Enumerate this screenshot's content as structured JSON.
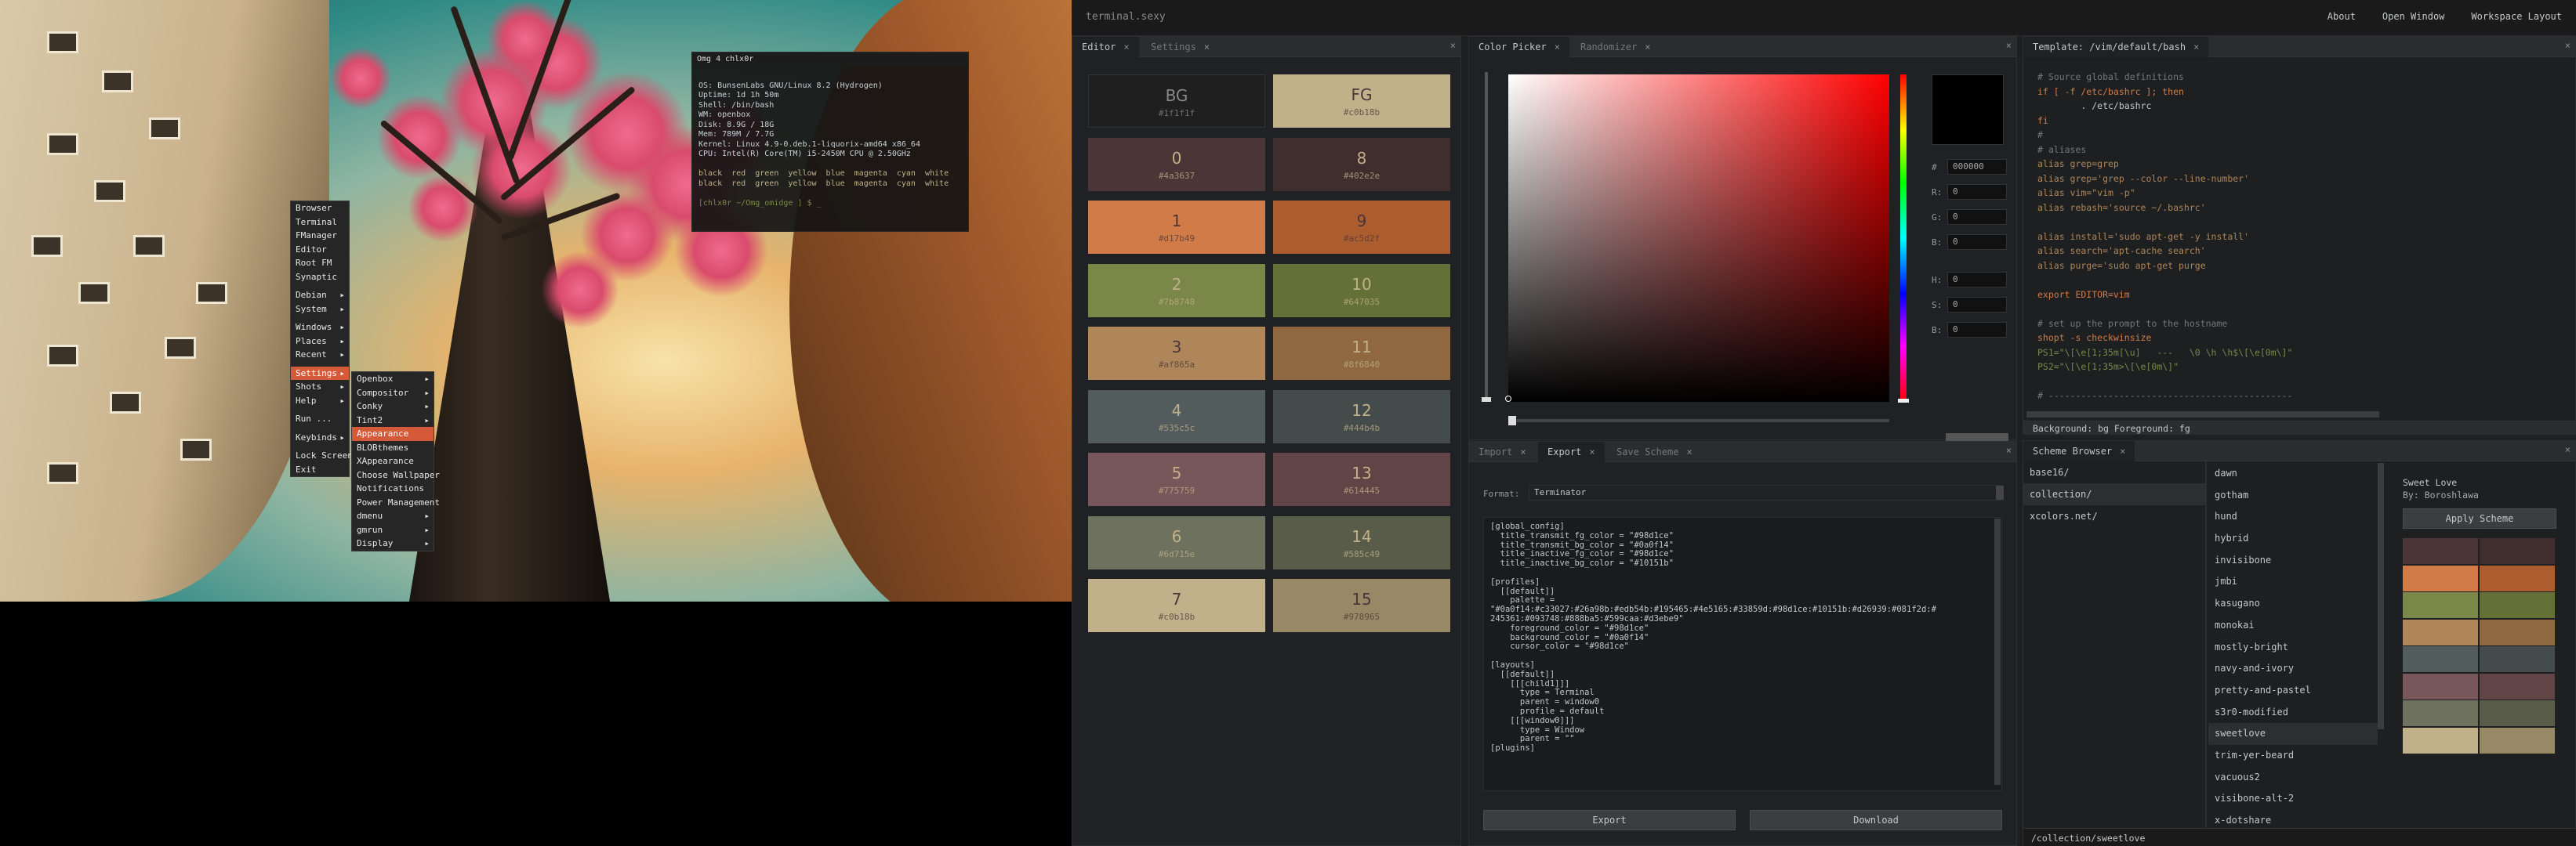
{
  "preview": {
    "term_title": "Omg 4 chlx0r",
    "term_lines": [
      "",
      "OS: BunsenLabs GNU/Linux 8.2 (Hydrogen)",
      "Uptime: 1d 1h 50m",
      "Shell: /bin/bash",
      "WM: openbox",
      "Disk: 8.9G / 18G",
      "Mem: 789M / 7.7G",
      "Kernel: Linux 4.9-0.deb.1-liquorix-amd64 x86_64",
      "CPU: Intel(R) Core(TM) i5-2450M CPU @ 2.50GHz",
      "",
      "black  red  green  yellow  blue  magenta  cyan  white",
      "black  red  green  yellow  blue  magenta  cyan  white",
      "",
      "[chlx0r ~/Omg_omidge ] $ _"
    ],
    "menu1": [
      {
        "t": "Browser"
      },
      {
        "t": "Terminal"
      },
      {
        "t": "FManager"
      },
      {
        "t": "Editor"
      },
      {
        "t": "Root FM"
      },
      {
        "t": "Synaptic"
      },
      {
        "t": "Debian",
        "a": true,
        "s": true
      },
      {
        "t": "System",
        "a": true
      },
      {
        "t": "Windows",
        "a": true,
        "s": true
      },
      {
        "t": "Places",
        "a": true
      },
      {
        "t": "Recent",
        "a": true
      },
      {
        "t": "Settings",
        "a": true,
        "s": true,
        "h": true
      },
      {
        "t": "Shots",
        "a": true
      },
      {
        "t": "Help",
        "a": true
      },
      {
        "t": "Run ...",
        "s": true
      },
      {
        "t": "Keybinds",
        "a": true,
        "s": true
      },
      {
        "t": "Lock Screen",
        "s": true
      },
      {
        "t": "Exit"
      }
    ],
    "menu2": [
      {
        "t": "Openbox",
        "a": true
      },
      {
        "t": "Compositor",
        "a": true
      },
      {
        "t": "Conky",
        "a": true
      },
      {
        "t": "Tint2",
        "a": true
      },
      {
        "t": "Appearance",
        "h": true
      },
      {
        "t": "BLOBthemes"
      },
      {
        "t": "XAppearance"
      },
      {
        "t": "Choose Wallpaper"
      },
      {
        "t": "Notifications"
      },
      {
        "t": "Power Management"
      },
      {
        "t": "dmenu",
        "a": true
      },
      {
        "t": "gmrun",
        "a": true
      },
      {
        "t": "Display",
        "a": true
      }
    ]
  },
  "nav": {
    "brand": "terminal.sexy",
    "links": [
      "About",
      "Open Window",
      "Workspace Layout"
    ]
  },
  "editor": {
    "tabs": [
      "Editor",
      "Settings"
    ],
    "swatches": [
      {
        "name": "BG",
        "hex": "#1f1f1f",
        "bg": "#1f1f1f",
        "fg": "#8a8a8a"
      },
      {
        "name": "FG",
        "hex": "#c0b18b",
        "bg": "#c0b18b",
        "fg": "#4a3637"
      },
      {
        "name": "0",
        "hex": "#4a3637",
        "bg": "#4a3637",
        "fg": "#c0b18b"
      },
      {
        "name": "8",
        "hex": "#402e2e",
        "bg": "#402e2e",
        "fg": "#c0b18b"
      },
      {
        "name": "1",
        "hex": "#d17b49",
        "bg": "#d17b49",
        "fg": "#4a3637"
      },
      {
        "name": "9",
        "hex": "#ac5d2f",
        "bg": "#ac5d2f",
        "fg": "#4a3637"
      },
      {
        "name": "2",
        "hex": "#7b8748",
        "bg": "#7b8748",
        "fg": "#c0b18b"
      },
      {
        "name": "10",
        "hex": "#647035",
        "bg": "#647035",
        "fg": "#c0b18b"
      },
      {
        "name": "3",
        "hex": "#af865a",
        "bg": "#af865a",
        "fg": "#4a3637"
      },
      {
        "name": "11",
        "hex": "#8f6840",
        "bg": "#8f6840",
        "fg": "#c0b18b"
      },
      {
        "name": "4",
        "hex": "#535c5c",
        "bg": "#535c5c",
        "fg": "#c0b18b"
      },
      {
        "name": "12",
        "hex": "#444b4b",
        "bg": "#444b4b",
        "fg": "#c0b18b"
      },
      {
        "name": "5",
        "hex": "#775759",
        "bg": "#775759",
        "fg": "#c0b18b"
      },
      {
        "name": "13",
        "hex": "#614445",
        "bg": "#614445",
        "fg": "#c0b18b"
      },
      {
        "name": "6",
        "hex": "#6d715e",
        "bg": "#6d715e",
        "fg": "#c0b18b"
      },
      {
        "name": "14",
        "hex": "#585c49",
        "bg": "#585c49",
        "fg": "#c0b18b"
      },
      {
        "name": "7",
        "hex": "#c0b18b",
        "bg": "#c0b18b",
        "fg": "#4a3637"
      },
      {
        "name": "15",
        "hex": "#978965",
        "bg": "#978965",
        "fg": "#4a3637"
      }
    ]
  },
  "picker": {
    "tabs": [
      "Color Picker",
      "Randomizer"
    ],
    "fields": [
      {
        "k": "#",
        "v": "000000"
      },
      {
        "k": "R:",
        "v": "0"
      },
      {
        "k": "G:",
        "v": "0"
      },
      {
        "k": "B:",
        "v": "0"
      },
      {
        "k": "H:",
        "v": "0"
      },
      {
        "k": "S:",
        "v": "0"
      },
      {
        "k": "B:",
        "v": "0"
      }
    ]
  },
  "template": {
    "tabs": [
      "Template: /vim/default/bash"
    ],
    "lines": [
      {
        "t": "# Source global definitions",
        "c": "#707880"
      },
      {
        "t": "if [ -f /etc/bashrc ]; then",
        "c": "#d17b49"
      },
      {
        "t": "        . /etc/bashrc",
        "c": "#c5c8c6"
      },
      {
        "t": "fi",
        "c": "#d17b49"
      },
      {
        "t": "#",
        "c": "#707880"
      },
      {
        "t": "# aliases",
        "c": "#707880"
      },
      {
        "t": "alias grep=grep",
        "c": "#af865a"
      },
      {
        "t": "alias grep='grep --color --line-number'",
        "c": "#af865a"
      },
      {
        "t": "alias vim=\"vim -p\"",
        "c": "#af865a"
      },
      {
        "t": "alias rebash='source ~/.bashrc'",
        "c": "#af865a"
      },
      {
        "t": "",
        "c": "#c5c8c6"
      },
      {
        "t": "alias install='sudo apt-get -y install'",
        "c": "#af865a"
      },
      {
        "t": "alias search='apt-cache search'",
        "c": "#af865a"
      },
      {
        "t": "alias purge='sudo apt-get purge",
        "c": "#af865a"
      },
      {
        "t": "",
        "c": "#c5c8c6"
      },
      {
        "t": "export EDITOR=vim",
        "c": "#d17b49"
      },
      {
        "t": "",
        "c": "#c5c8c6"
      },
      {
        "t": "# set up the prompt to the hostname",
        "c": "#707880"
      },
      {
        "t": "shopt -s checkwinsize",
        "c": "#d17b49"
      },
      {
        "t": "PS1=\"\\[\\e[1;35m[\\u]   ---   \\0 \\h \\h$\\[\\e[0m\\]\"",
        "c": "#7b8748"
      },
      {
        "t": "PS2=\"\\[\\e[1;35m>\\[\\e[0m\\]\"",
        "c": "#7b8748"
      },
      {
        "t": "",
        "c": "#c5c8c6"
      },
      {
        "t": "# ---------------------------------------------",
        "c": "#707880"
      }
    ],
    "status": "Background: bg Foreground: fg"
  },
  "export": {
    "tabs": [
      "Import",
      "Export",
      "Save Scheme"
    ],
    "format_label": "Format:",
    "format_value": "Terminator",
    "text": "[global_config]\n  title_transmit_fg_color = \"#98d1ce\"\n  title_transmit_bg_color = \"#0a0f14\"\n  title_inactive_fg_color = \"#98d1ce\"\n  title_inactive_bg_color = \"#10151b\"\n\n[profiles]\n  [[default]]\n    palette =\n\"#0a0f14:#c33027:#26a98b:#edb54b:#195465:#4e5165:#33859d:#98d1ce:#10151b:#d26939:#081f2d:#\n245361:#093748:#888ba5:#599caa:#d3ebe9\"\n    foreground_color = \"#98d1ce\"\n    background_color = \"#0a0f14\"\n    cursor_color = \"#98d1ce\"\n\n[layouts]\n  [[default]]\n    [[[child1]]]\n      type = Terminal\n      parent = window0\n      profile = default\n    [[[window0]]]\n      type = Window\n      parent = \"\"\n[plugins]",
    "export_btn": "Export",
    "download_btn": "Download"
  },
  "browser": {
    "tabs": [
      "Scheme Browser"
    ],
    "folders": [
      "base16/",
      "collection/",
      "xcolors.net/"
    ],
    "schemes": [
      "dawn",
      "gotham",
      "hund",
      "hybrid",
      "invisibone",
      "jmbi",
      "kasugano",
      "monokai",
      "mostly-bright",
      "navy-and-ivory",
      "pretty-and-pastel",
      "s3r0-modified",
      "sweetlove",
      "trim-yer-beard",
      "vacuous2",
      "visibone-alt-2",
      "x-dotshare"
    ],
    "selected": "sweetlove",
    "info_name": "Sweet Love",
    "info_by": "By: Boroshlawa",
    "apply": "Apply Scheme",
    "path": "/collection/sweetlove",
    "colors": [
      "#4a3637",
      "#402e2e",
      "#d17b49",
      "#ac5d2f",
      "#7b8748",
      "#647035",
      "#af865a",
      "#8f6840",
      "#535c5c",
      "#444b4b",
      "#775759",
      "#614445",
      "#6d715e",
      "#585c49",
      "#c0b18b",
      "#978965"
    ]
  }
}
